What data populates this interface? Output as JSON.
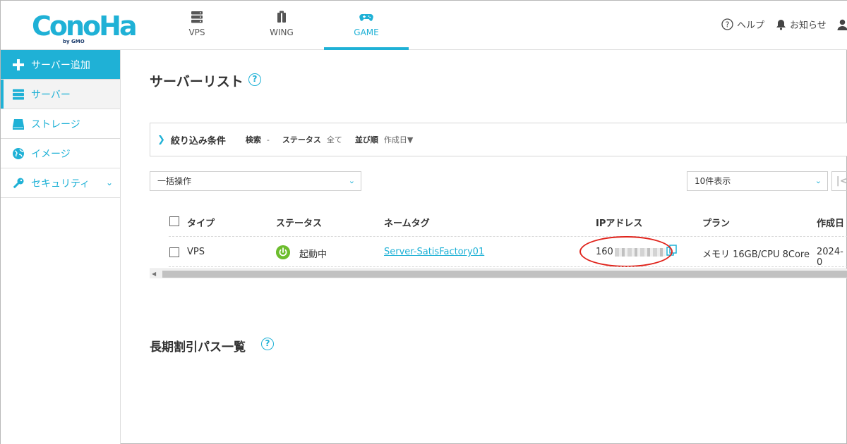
{
  "header": {
    "logo_text": "ConoHa",
    "logo_sub": "by GMO",
    "tabs": [
      {
        "label": "VPS",
        "icon": "server-stack-icon"
      },
      {
        "label": "WING",
        "icon": "wing-icon"
      },
      {
        "label": "GAME",
        "icon": "gamepad-icon",
        "active": true
      }
    ],
    "help_label": "ヘルプ",
    "notice_label": "お知らせ"
  },
  "sidebar": {
    "items": [
      {
        "label": "サーバー追加",
        "icon": "plus-icon"
      },
      {
        "label": "サーバー",
        "icon": "server-icon"
      },
      {
        "label": "ストレージ",
        "icon": "storage-icon"
      },
      {
        "label": "イメージ",
        "icon": "globe-icon"
      },
      {
        "label": "セキュリティ",
        "icon": "key-icon"
      }
    ]
  },
  "main": {
    "title": "サーバーリスト",
    "filter": {
      "title": "絞り込み条件",
      "search_label": "検索",
      "search_value": "-",
      "status_label": "ステータス",
      "status_value": "全て",
      "sort_label": "並び順",
      "sort_value": "作成日▼"
    },
    "bulk_select": "一括操作",
    "page_size_select": "10件表示",
    "table": {
      "headers": [
        "タイプ",
        "ステータス",
        "ネームタグ",
        "IPアドレス",
        "プラン",
        "作成日"
      ],
      "rows": [
        {
          "type": "VPS",
          "status": "起動中",
          "name_tag": "Server-SatisFactory01",
          "ip_prefix": "160",
          "plan": "メモリ 16GB/CPU 8Core",
          "created": "2024-0"
        }
      ]
    },
    "section2_title": "長期割引パス一覧"
  },
  "colors": {
    "accent": "#1fb1d6",
    "status_running": "#6dbd2e",
    "annotation_red": "#e0231b"
  }
}
